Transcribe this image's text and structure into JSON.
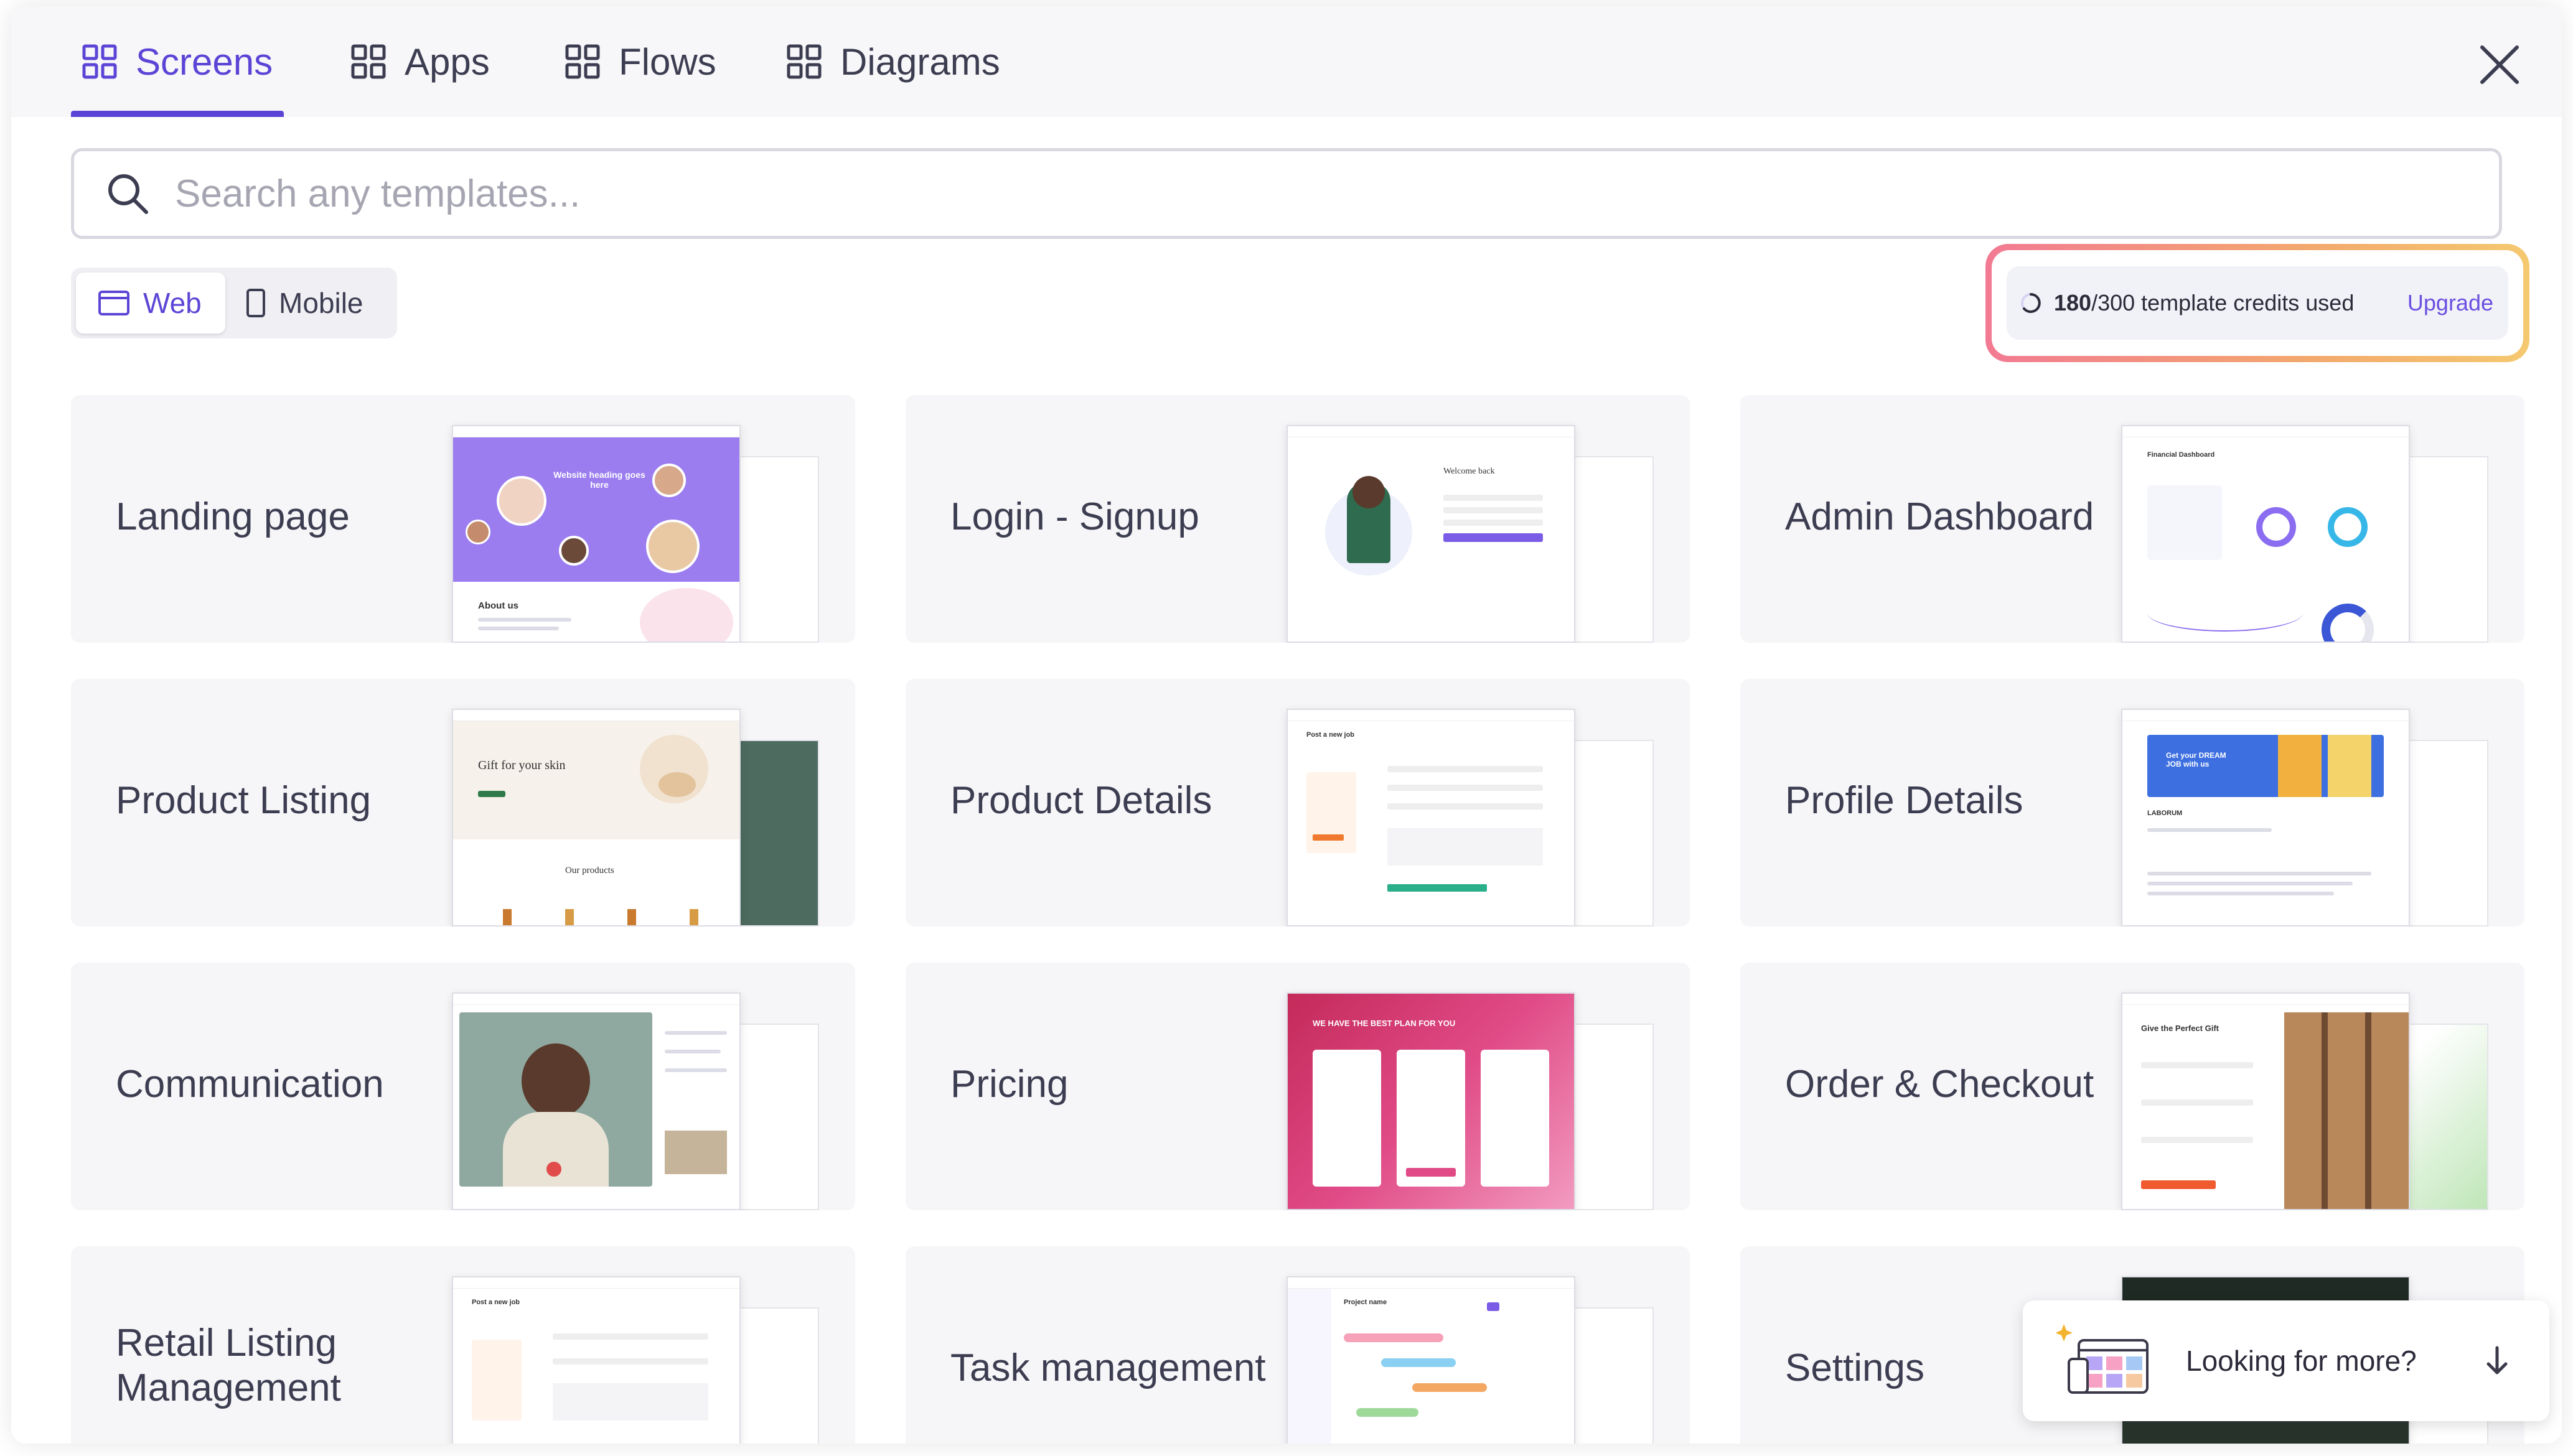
{
  "tabs": [
    {
      "label": "Screens",
      "active": true
    },
    {
      "label": "Apps",
      "active": false
    },
    {
      "label": "Flows",
      "active": false
    },
    {
      "label": "Diagrams",
      "active": false
    }
  ],
  "search": {
    "placeholder": "Search any templates..."
  },
  "platform_toggle": {
    "web_label": "Web",
    "mobile_label": "Mobile",
    "selected": "Web"
  },
  "credits": {
    "used": "180",
    "total": "/300",
    "suffix": " template credits used",
    "upgrade_label": "Upgrade"
  },
  "cards": [
    {
      "title": "Landing page"
    },
    {
      "title": "Login - Signup"
    },
    {
      "title": "Admin Dashboard"
    },
    {
      "title": "Product Listing"
    },
    {
      "title": "Product Details"
    },
    {
      "title": "Profile Details"
    },
    {
      "title": "Communication"
    },
    {
      "title": "Pricing"
    },
    {
      "title": "Order & Checkout"
    },
    {
      "title": "Retail Listing Management"
    },
    {
      "title": "Task management"
    },
    {
      "title": "Settings"
    }
  ],
  "thumb_text": {
    "landing_heading": "Website heading goes here",
    "landing_about": "About us",
    "login_heading": "Welcome back",
    "admin_heading": "Financial Dashboard",
    "listing_heading": "Gift for your skin",
    "listing_sub": "Our products",
    "details_heading": "Post a new job",
    "profile_heading": "Get your DREAM JOB with us",
    "profile_company": "LABORUM",
    "pricing_heading": "WE HAVE THE BEST PLAN FOR YOU",
    "checkout_heading": "Give the Perfect Gift",
    "retail_heading": "Post a new job",
    "task_heading": "Project name"
  },
  "looking_for_more": {
    "label": "Looking for more?"
  },
  "colors": {
    "accent": "#5b45d6",
    "landing_purple": "#9b7df0",
    "pricing_pink": "#e04a86",
    "profile_blue": "#3d6fe0"
  }
}
